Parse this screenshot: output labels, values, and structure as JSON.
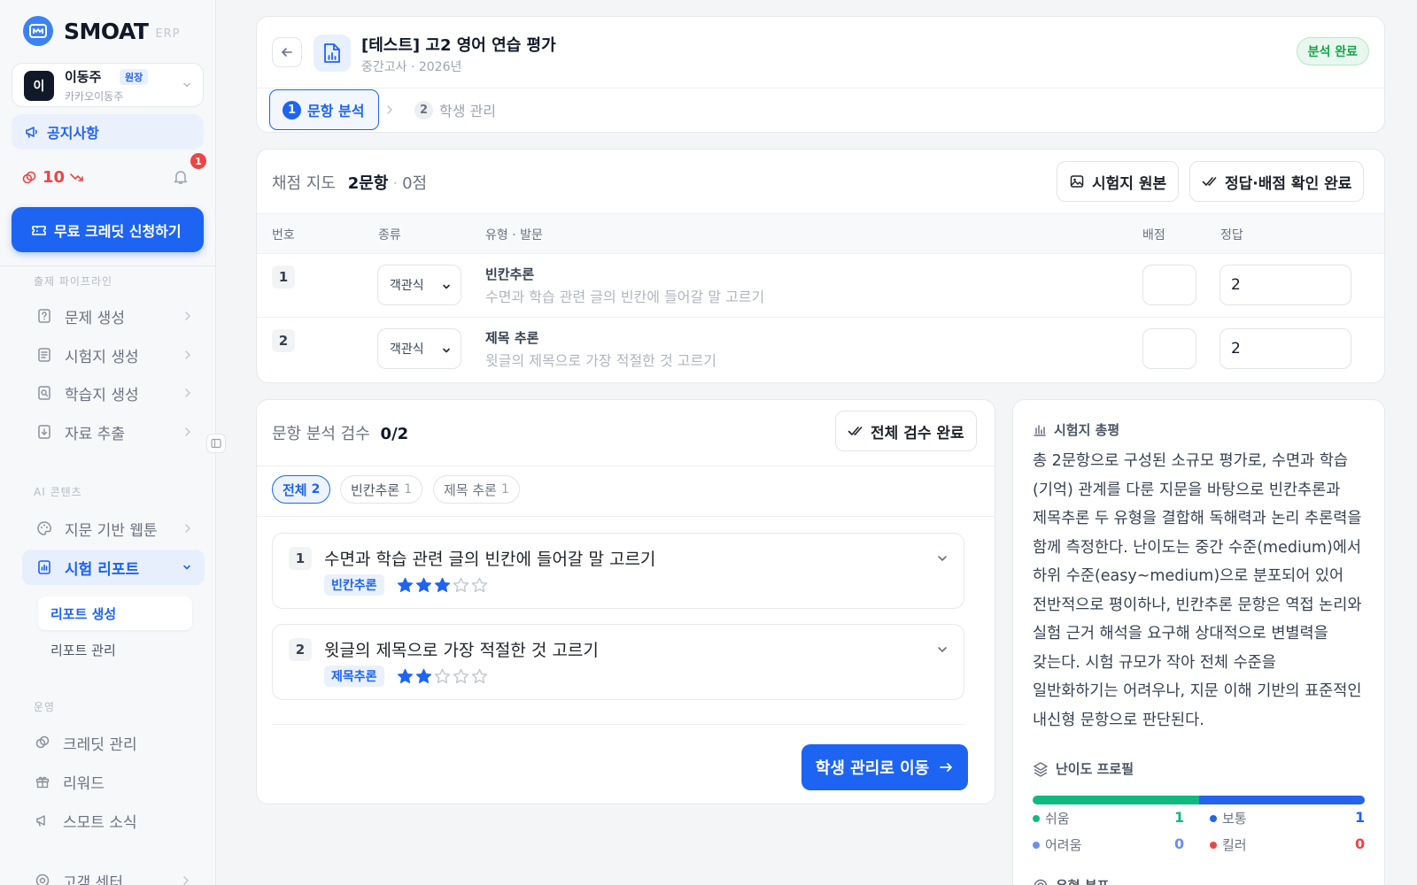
{
  "brand": {
    "name": "SMOAT",
    "sub": "ERP"
  },
  "user": {
    "avatar": "이",
    "name": "이동주",
    "role": "원장",
    "account": "카카오이동주"
  },
  "sidebar": {
    "notice": "공지사항",
    "credits": "10",
    "notification_count": "1",
    "free_credit_button": "무료 크레딧 신청하기",
    "sections": [
      {
        "title": "출제 파이프라인",
        "items": [
          {
            "label": "문제 생성",
            "icon": "question-icon"
          },
          {
            "label": "시험지 생성",
            "icon": "document-icon"
          },
          {
            "label": "학습지 생성",
            "icon": "search-doc-icon"
          },
          {
            "label": "자료 추출",
            "icon": "extract-icon"
          }
        ]
      },
      {
        "title": "AI 콘텐츠",
        "items": [
          {
            "label": "지문 기반 웹툰",
            "icon": "palette-icon"
          },
          {
            "label": "시험 리포트",
            "icon": "chart-doc-icon"
          }
        ]
      },
      {
        "title": "운영",
        "items": [
          {
            "label": "크레딧 관리",
            "icon": "coins-icon"
          },
          {
            "label": "리워드",
            "icon": "gift-icon"
          },
          {
            "label": "스모트 소식",
            "icon": "megaphone-icon"
          },
          {
            "label": "고객 센터",
            "icon": "support-icon"
          }
        ]
      }
    ],
    "report_subitems": [
      "리포트 생성",
      "리포트 관리"
    ]
  },
  "exam": {
    "title": "[테스트] 고2 영어 연습 평가",
    "subtitle": "중간고사 · 2026년",
    "status": "분석 완료",
    "steps": [
      {
        "num": "1",
        "label": "문항 분석"
      },
      {
        "num": "2",
        "label": "학생 관리"
      }
    ]
  },
  "grading": {
    "title_prefix": "채점 지도",
    "count": "2문항",
    "points": "0점",
    "original_button": "시험지 원본",
    "confirm_button": "정답·배점 확인 완료",
    "headers": {
      "num": "번호",
      "kind": "종류",
      "type": "유형 · 발문",
      "score": "배점",
      "answer": "정답"
    },
    "rows": [
      {
        "num": "1",
        "kind": "객관식",
        "type": "빈칸추론",
        "prompt": "수면과 학습 관련 글의 빈칸에 들어갈 말 고르기",
        "score": "",
        "answer": "2"
      },
      {
        "num": "2",
        "kind": "객관식",
        "type": "제목 추론",
        "prompt": "윗글의 제목으로 가장 적절한 것 고르기",
        "score": "",
        "answer": "2"
      }
    ]
  },
  "review": {
    "title_prefix": "문항 분석 검수",
    "progress": "0/2",
    "complete_button": "전체 검수 완료",
    "chips": [
      {
        "label": "전체",
        "count": "2"
      },
      {
        "label": "빈칸추론",
        "count": "1"
      },
      {
        "label": "제목 추론",
        "count": "1"
      }
    ],
    "items": [
      {
        "num": "1",
        "text": "수면과 학습 관련 글의 빈칸에 들어갈 말 고르기",
        "tag": "빈칸추론",
        "stars": 3
      },
      {
        "num": "2",
        "text": "윗글의 제목으로 가장 적절한 것 고르기",
        "tag": "제목추론",
        "stars": 2
      }
    ],
    "next_button": "학생 관리로 이동"
  },
  "summary": {
    "title": "시험지 총평",
    "text": "총 2문항으로 구성된 소규모 평가로, 수면과 학습(기억) 관계를 다룬 지문을 바탕으로 빈칸추론과 제목추론 두 유형을 결합해 독해력과 논리 추론력을 함께 측정한다. 난이도는 중간 수준(medium)에서 하위 수준(easy~medium)으로 분포되어 있어 전반적으로 평이하나, 빈칸추론 문항은 역접 논리와 실험 근거 해석을 요구해 상대적으로 변별력을 갖는다. 시험 규모가 작아 전체 수준을 일반화하기는 어려우나, 지문 이해 기반의 표준적인 내신형 문항으로 판단된다.",
    "difficulty_title": "난이도 프로필",
    "difficulty": [
      {
        "label": "쉬움",
        "value": 1,
        "color": "#10b981"
      },
      {
        "label": "보통",
        "value": 1,
        "color": "#2563eb"
      },
      {
        "label": "어려움",
        "value": 0,
        "color": "#6b8ef0"
      },
      {
        "label": "킬러",
        "value": 0,
        "color": "#ef4444"
      }
    ],
    "type_title": "유형 분포"
  }
}
